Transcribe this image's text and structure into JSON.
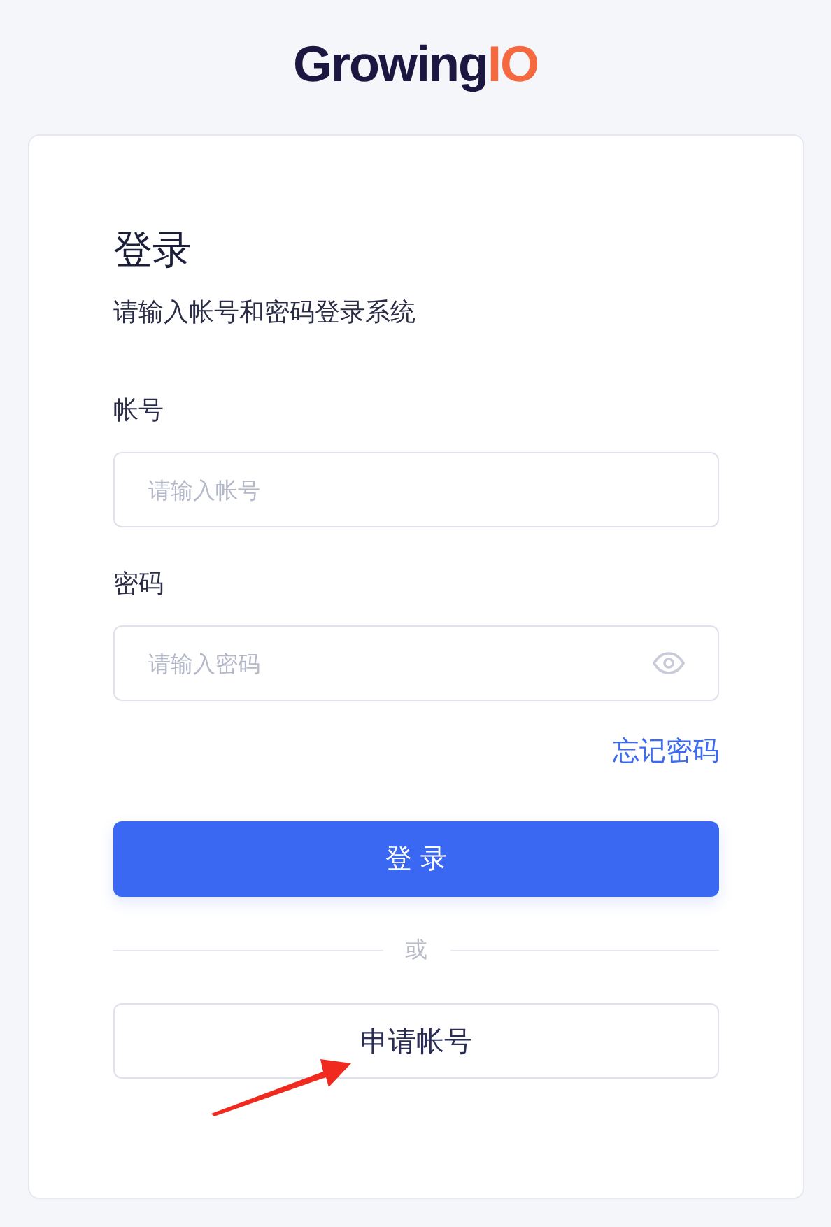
{
  "logo": {
    "main": "Growing",
    "accent": "IO"
  },
  "title": "登录",
  "subtitle": "请输入帐号和密码登录系统",
  "fields": [
    {
      "kind": "text",
      "label": "帐号",
      "placeholder": "请输入帐号"
    },
    {
      "kind": "password",
      "label": "密码",
      "placeholder": "请输入密码"
    }
  ],
  "forgot_link": "忘记密码",
  "login_button": "登 录",
  "divider_text": "或",
  "apply_button": "申请帐号"
}
